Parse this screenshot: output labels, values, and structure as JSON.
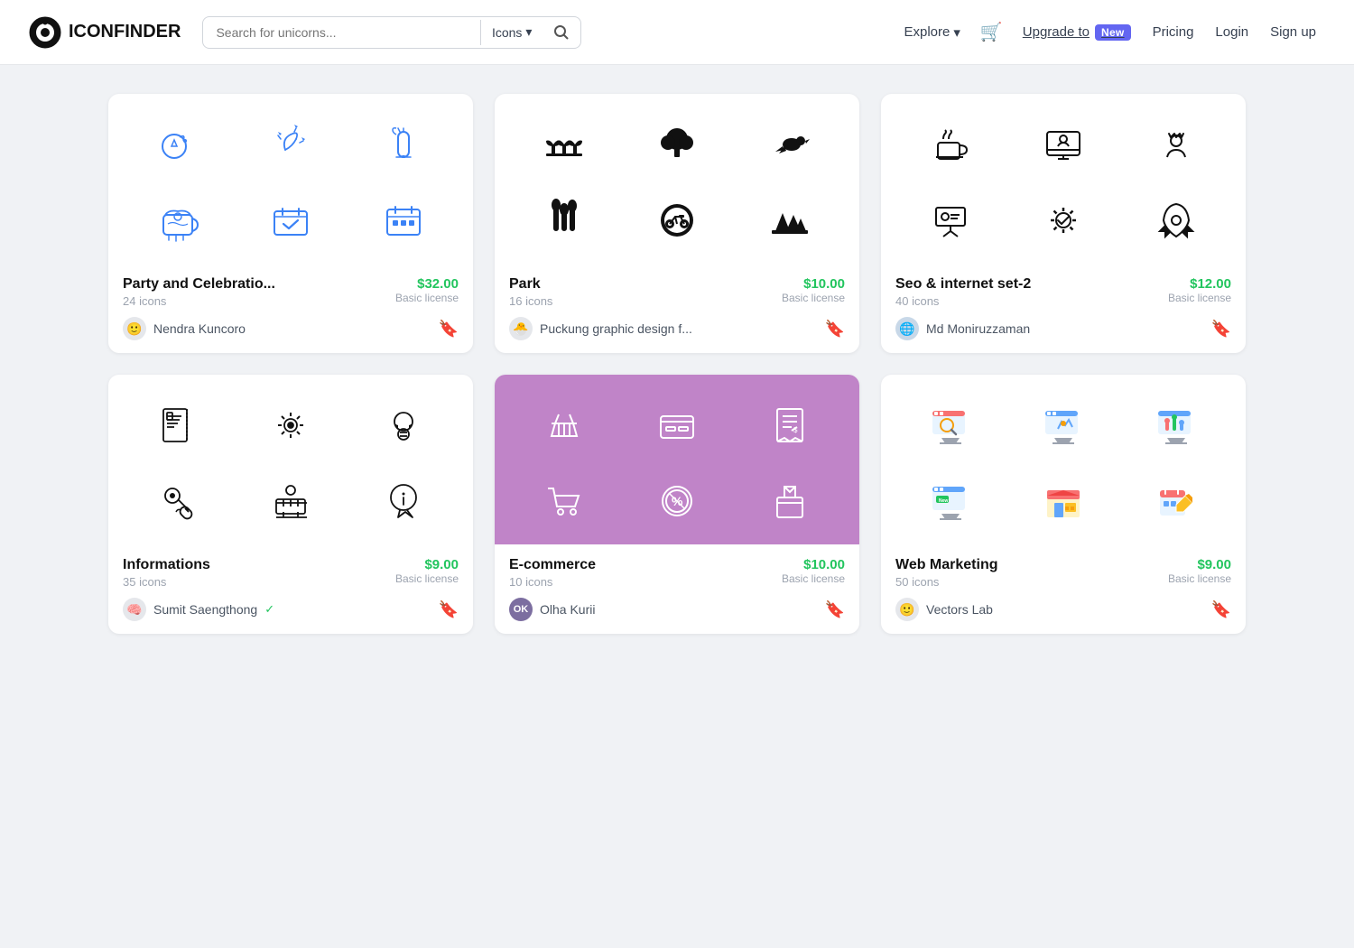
{
  "header": {
    "logo_text": "ICONFINDER",
    "search_placeholder": "Search for unicorns...",
    "search_type": "Icons",
    "explore": "Explore",
    "cart_label": "Cart",
    "upgrade_text": "Upgrade to",
    "new_badge": "New",
    "pricing": "Pricing",
    "login": "Login",
    "signup": "Sign up"
  },
  "cards": [
    {
      "id": "party",
      "title": "Party and Celebratio...",
      "count": "24 icons",
      "price": "$32.00",
      "license": "Basic license",
      "author": "Nendra Kuncoro",
      "author_verified": false,
      "bg": "white",
      "style": "blue-outline"
    },
    {
      "id": "park",
      "title": "Park",
      "count": "16 icons",
      "price": "$10.00",
      "license": "Basic license",
      "author": "Puckung graphic design f...",
      "author_verified": false,
      "bg": "white",
      "style": "black-fill"
    },
    {
      "id": "seo",
      "title": "Seo & internet set-2",
      "count": "40 icons",
      "price": "$12.00",
      "license": "Basic license",
      "author": "Md Moniruzzaman",
      "author_verified": false,
      "bg": "white",
      "style": "black-outline"
    },
    {
      "id": "informations",
      "title": "Informations",
      "count": "35 icons",
      "price": "$9.00",
      "license": "Basic license",
      "author": "Sumit Saengthong",
      "author_verified": true,
      "bg": "white",
      "style": "black-outline"
    },
    {
      "id": "ecommerce",
      "title": "E-commerce",
      "count": "10 icons",
      "price": "$10.00",
      "license": "Basic license",
      "author": "Olha Kurii",
      "author_verified": false,
      "bg": "purple",
      "style": "white-outline"
    },
    {
      "id": "webmarketing",
      "title": "Web Marketing",
      "count": "50 icons",
      "price": "$9.00",
      "license": "Basic license",
      "author": "Vectors Lab",
      "author_verified": false,
      "bg": "white",
      "style": "color"
    }
  ]
}
